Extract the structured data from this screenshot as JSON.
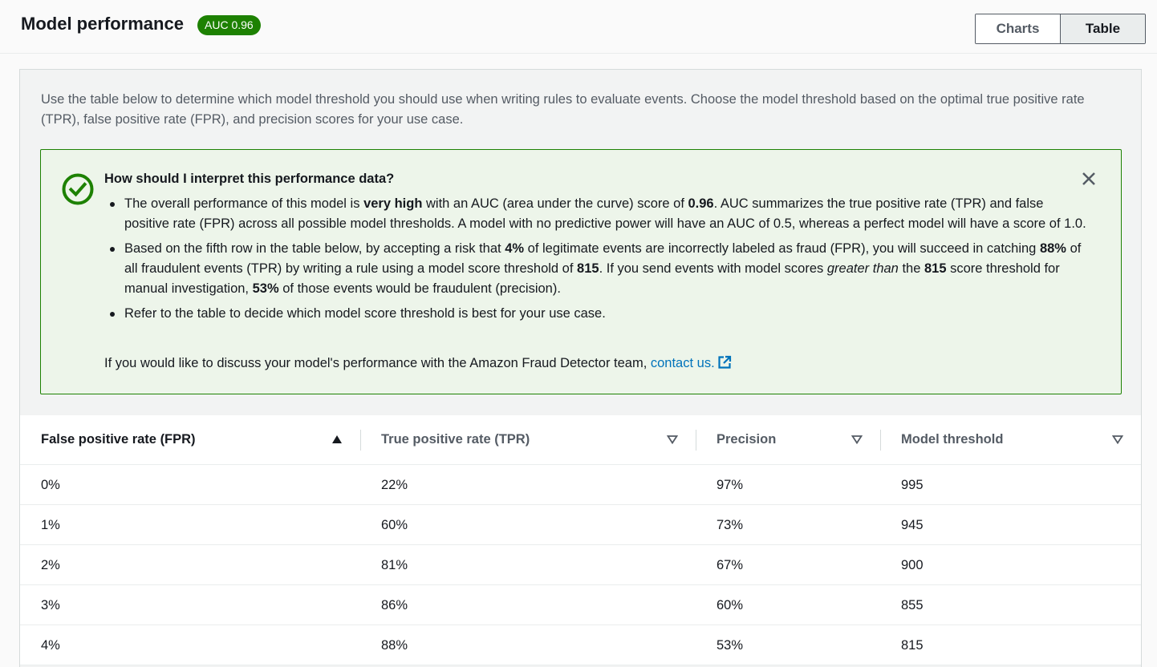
{
  "header": {
    "title": "Model performance",
    "badge": "AUC 0.96",
    "tabs": [
      {
        "label": "Charts",
        "active": false
      },
      {
        "label": "Table",
        "active": true
      }
    ]
  },
  "description": "Use the table below to determine which model threshold you should use when writing rules to evaluate events. Choose the model threshold based on the optimal true positive rate (TPR), false positive rate (FPR), and precision scores for your use case.",
  "alert": {
    "title": "How should I interpret this performance data?",
    "bullet1": {
      "a": "The overall performance of this model is ",
      "b": "very high",
      "c": " with an AUC (area under the curve) score of ",
      "d": "0.96",
      "e": ". AUC summarizes the true positive rate (TPR) and false positive rate (FPR) across all possible model thresholds. A model with no predictive power will have an AUC of 0.5, whereas a perfect model will have a score of 1.0."
    },
    "bullet2": {
      "a": "Based on the fifth row in the table below, by accepting a risk that ",
      "b": "4%",
      "c": " of legitimate events are incorrectly labeled as fraud (FPR), you will succeed in catching ",
      "d": "88%",
      "e": " of all fraudulent events (TPR) by writing a rule using a model score threshold of ",
      "f": "815",
      "g": ". If you send events with model scores ",
      "h": "greater than",
      "i": " the ",
      "j": "815",
      "k": " score threshold for manual investigation, ",
      "l": "53%",
      "m": " of those events would be fraudulent (precision)."
    },
    "bullet3": "Refer to the table to decide which model score threshold is best for your use case.",
    "footer_text": "If you would like to discuss your model's performance with the Amazon Fraud Detector team, ",
    "footer_link": "contact us.",
    "success_color": "#1d8102",
    "icons": [
      "check-circle-icon",
      "close-icon",
      "external-link-icon"
    ]
  },
  "table": {
    "columns": [
      {
        "label": "False positive rate (FPR)",
        "sort": "ascending"
      },
      {
        "label": "True positive rate (TPR)",
        "sort": "none"
      },
      {
        "label": "Precision",
        "sort": "none"
      },
      {
        "label": "Model threshold",
        "sort": "none"
      }
    ],
    "rows": [
      [
        "0%",
        "22%",
        "97%",
        "995"
      ],
      [
        "1%",
        "60%",
        "73%",
        "945"
      ],
      [
        "2%",
        "81%",
        "67%",
        "900"
      ],
      [
        "3%",
        "86%",
        "60%",
        "855"
      ],
      [
        "4%",
        "88%",
        "53%",
        "815"
      ]
    ]
  }
}
